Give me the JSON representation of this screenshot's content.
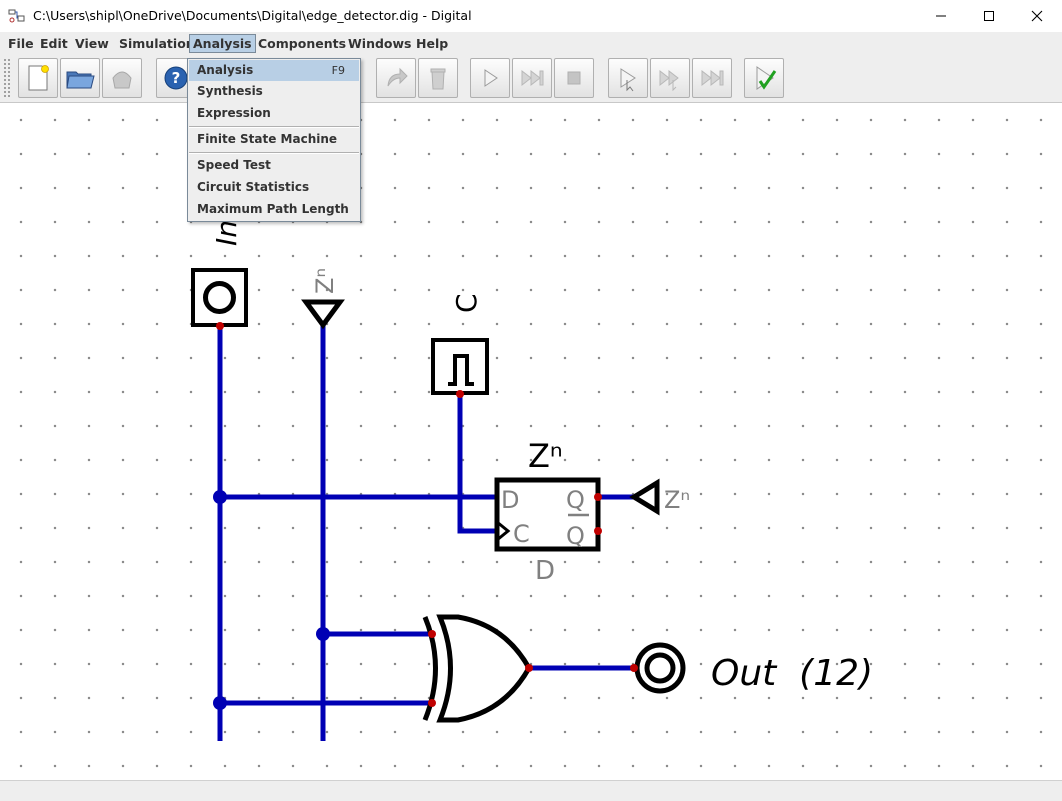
{
  "window": {
    "title": "C:\\Users\\shipl\\OneDrive\\Documents\\Digital\\edge_detector.dig - Digital"
  },
  "menubar": {
    "items": [
      "File",
      "Edit",
      "View",
      "Simulation",
      "Analysis",
      "Components",
      "Windows",
      "Help"
    ],
    "active": "Analysis"
  },
  "analysis_menu": {
    "items": [
      {
        "label": "Analysis",
        "accelerator": "F9"
      },
      {
        "label": "Synthesis",
        "accelerator": ""
      },
      {
        "label": "Expression",
        "accelerator": ""
      },
      {
        "label": "Finite State Machine",
        "accelerator": ""
      },
      {
        "label": "Speed Test",
        "accelerator": ""
      },
      {
        "label": "Circuit Statistics",
        "accelerator": ""
      },
      {
        "label": "Maximum Path Length",
        "accelerator": ""
      }
    ]
  },
  "toolbar": {
    "buttons": [
      "new-file-icon",
      "open-file-icon",
      "save-icon",
      "help-icon",
      "redo-icon",
      "delete-icon",
      "run-icon",
      "fast-forward-icon",
      "stop-icon",
      "step-icon",
      "step-multiple-icon",
      "step-fast-icon",
      "check-icon"
    ]
  },
  "circuit": {
    "input_label": "In",
    "tunnel_label": "Zⁿ",
    "clock_label": "C",
    "dff_title": "Zⁿ",
    "dff_type": "D",
    "dff_pin_d": "D",
    "dff_pin_c": "C",
    "dff_pin_q": "Q",
    "dff_pin_qn": "Q",
    "tunnel_out_label": "Zⁿ",
    "output_label": "Out  (12)",
    "wire_color": "#0000b4",
    "pin_color": "#c00000"
  }
}
